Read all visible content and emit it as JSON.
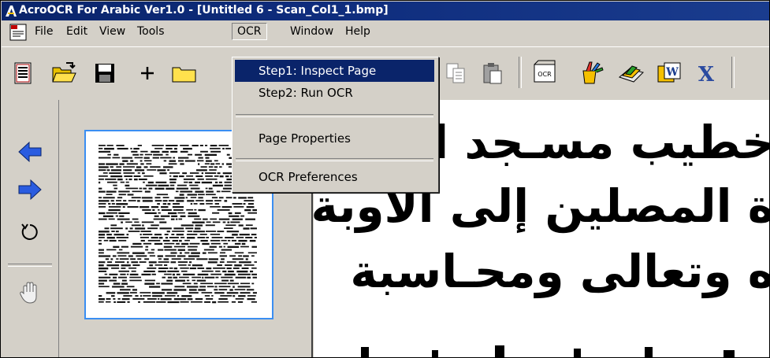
{
  "window": {
    "title": "AcroOCR For Arabic Ver1.0 - [Untitled 6 - Scan_Col1_1.bmp]",
    "title_bar_color": "#0a246a"
  },
  "menubar": {
    "items": [
      {
        "label": "File"
      },
      {
        "label": "Edit"
      },
      {
        "label": "View"
      },
      {
        "label": "Tools"
      },
      {
        "label": "OCR",
        "active": true
      },
      {
        "label": "Window"
      },
      {
        "label": "Help"
      }
    ]
  },
  "ocr_menu": {
    "items": [
      {
        "label": "Step1: Inspect Page",
        "highlighted": true
      },
      {
        "label": "Step2: Run OCR"
      },
      {
        "label": "Page Properties"
      },
      {
        "label": "OCR Preferences"
      }
    ],
    "highlight_color": "#0a246a"
  },
  "toolbar": {
    "icons": [
      "document-list-icon",
      "open-folder-icon",
      "save-disk-icon",
      "plus-icon",
      "folder-icon",
      "copy-icon",
      "paste-icon",
      "ocr-text-icon",
      "paint-icon",
      "scanner-icon",
      "word-export-icon",
      "excel-export-icon"
    ],
    "plus_label": "+",
    "ocr_label": "OCR"
  },
  "left_tools": {
    "icons": [
      "back-arrow-icon",
      "forward-arrow-icon",
      "rotate-icon",
      "hand-icon"
    ]
  },
  "thumbnail": {
    "selection_color": "#3a8ef2"
  },
  "document": {
    "lines": [
      "خطيب مسـجد الس",
      "ة المصلين إلى الأوبة",
      "ه وتعالى ومحـاسبة"
    ]
  }
}
